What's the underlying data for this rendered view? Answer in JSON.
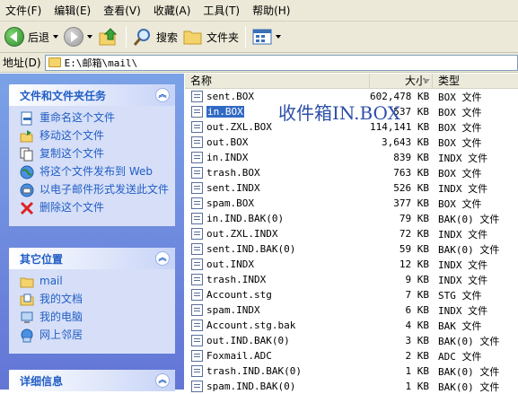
{
  "menu": [
    "文件(F)",
    "编辑(E)",
    "查看(V)",
    "收藏(A)",
    "工具(T)",
    "帮助(H)"
  ],
  "toolbar": {
    "back": "后退",
    "search": "搜索",
    "folders": "文件夹"
  },
  "address": {
    "label": "地址(D)",
    "path": "E:\\邮箱\\mail\\"
  },
  "tasks": {
    "title": "文件和文件夹任务",
    "items": [
      "重命名这个文件",
      "移动这个文件",
      "复制这个文件",
      "将这个文件发布到 Web",
      "以电子邮件形式发送此文件",
      "删除这个文件"
    ]
  },
  "other": {
    "title": "其它位置",
    "items": [
      "mail",
      "我的文档",
      "我的电脑",
      "网上邻居"
    ]
  },
  "details": {
    "title": "详细信息"
  },
  "columns": {
    "name": "名称",
    "size": "大小",
    "type": "类型"
  },
  "files": [
    {
      "name": "sent.BOX",
      "size": "602,478 KB",
      "type": "BOX 文件"
    },
    {
      "name": "in.BOX",
      "size": "537 KB",
      "type": "BOX 文件"
    },
    {
      "name": "out.ZXL.BOX",
      "size": "114,141 KB",
      "type": "BOX 文件"
    },
    {
      "name": "out.BOX",
      "size": "3,643 KB",
      "type": "BOX 文件"
    },
    {
      "name": "in.INDX",
      "size": "839 KB",
      "type": "INDX 文件"
    },
    {
      "name": "trash.BOX",
      "size": "763 KB",
      "type": "BOX 文件"
    },
    {
      "name": "sent.INDX",
      "size": "526 KB",
      "type": "INDX 文件"
    },
    {
      "name": "spam.BOX",
      "size": "377 KB",
      "type": "BOX 文件"
    },
    {
      "name": "in.IND.BAK(0)",
      "size": "79 KB",
      "type": "BAK(0) 文件"
    },
    {
      "name": "out.ZXL.INDX",
      "size": "72 KB",
      "type": "INDX 文件"
    },
    {
      "name": "sent.IND.BAK(0)",
      "size": "59 KB",
      "type": "BAK(0) 文件"
    },
    {
      "name": "out.INDX",
      "size": "12 KB",
      "type": "INDX 文件"
    },
    {
      "name": "trash.INDX",
      "size": "9 KB",
      "type": "INDX 文件"
    },
    {
      "name": "Account.stg",
      "size": "7 KB",
      "type": "STG 文件"
    },
    {
      "name": "spam.INDX",
      "size": "6 KB",
      "type": "INDX 文件"
    },
    {
      "name": "Account.stg.bak",
      "size": "4 KB",
      "type": "BAK 文件"
    },
    {
      "name": "out.IND.BAK(0)",
      "size": "3 KB",
      "type": "BAK(0) 文件"
    },
    {
      "name": "Foxmail.ADC",
      "size": "2 KB",
      "type": "ADC 文件"
    },
    {
      "name": "trash.IND.BAK(0)",
      "size": "1 KB",
      "type": "BAK(0) 文件"
    },
    {
      "name": "spam.IND.BAK(0)",
      "size": "1 KB",
      "type": "BAK(0) 文件"
    }
  ],
  "overlay": "收件箱IN.BOX"
}
